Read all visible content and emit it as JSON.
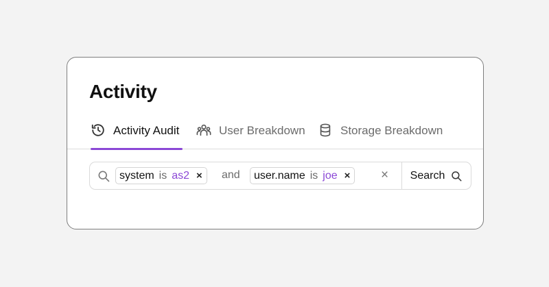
{
  "card": {
    "title": "Activity"
  },
  "tabs": [
    {
      "label": "Activity Audit",
      "icon": "history-icon",
      "active": true
    },
    {
      "label": "User Breakdown",
      "icon": "users-icon",
      "active": false
    },
    {
      "label": "Storage Breakdown",
      "icon": "database-icon",
      "active": false
    }
  ],
  "search": {
    "filters": [
      {
        "field": "system",
        "operator": "is",
        "value": "as2",
        "remove": "×"
      },
      {
        "field": "user.name",
        "operator": "is",
        "value": "joe",
        "remove": "×"
      }
    ],
    "joiner": "and",
    "clear_label": "×",
    "button_label": "Search"
  },
  "colors": {
    "accent": "#8b47d6",
    "background": "#f3f3f3",
    "card": "#ffffff",
    "border": "#7d7d7d"
  }
}
